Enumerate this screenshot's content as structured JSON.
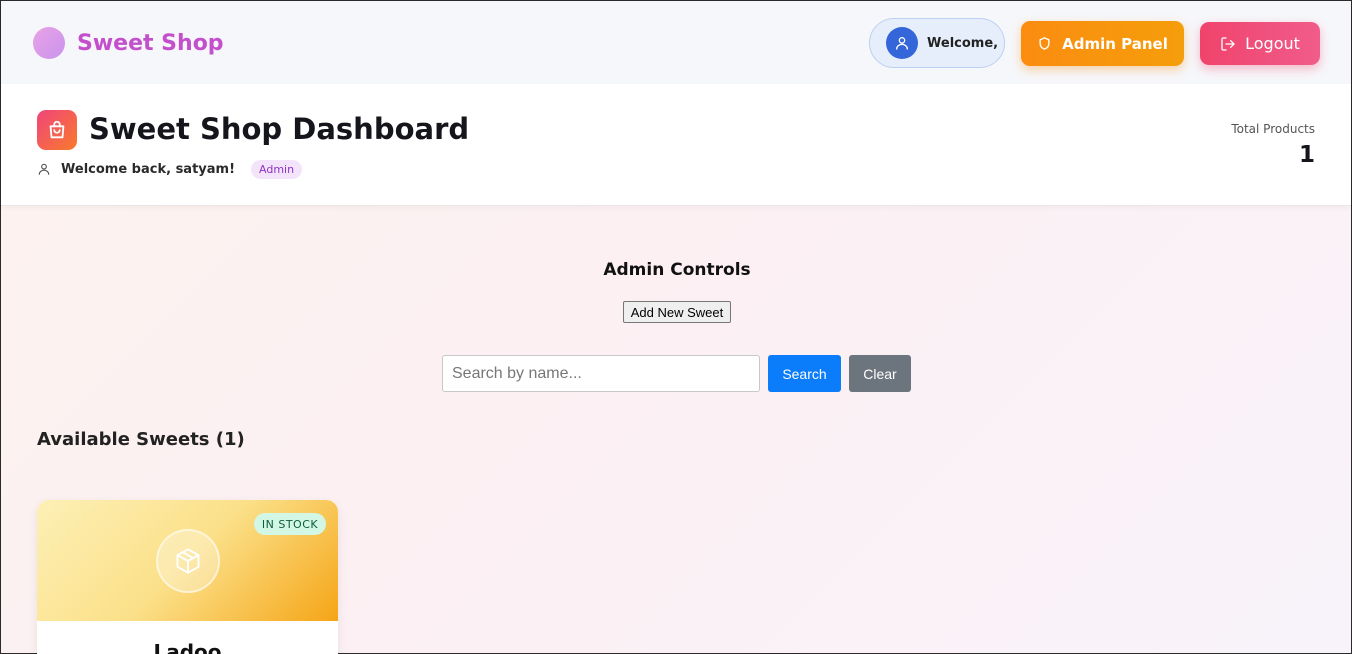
{
  "brand": {
    "name": "Sweet Shop"
  },
  "nav": {
    "welcome_text": "Welcome,",
    "admin_panel_label": "Admin Panel",
    "logout_label": "Logout"
  },
  "header": {
    "title": "Sweet Shop Dashboard",
    "welcome_message": "Welcome back, satyam!",
    "role_badge": "Admin",
    "total_products_label": "Total Products",
    "total_products_value": "1"
  },
  "admin_controls": {
    "title": "Admin Controls",
    "add_button_label": "Add New Sweet"
  },
  "search": {
    "placeholder": "Search by name...",
    "value": "",
    "search_label": "Search",
    "clear_label": "Clear"
  },
  "products_section": {
    "title": "Available Sweets (1)",
    "items": [
      {
        "name": "Ladoo",
        "stock_status": "IN STOCK"
      }
    ]
  },
  "colors": {
    "brand_text": "#c34fcc",
    "admin_panel_bg": "#fb8c10",
    "logout_bg": "#f0436c",
    "search_button_bg": "#0b7dfb",
    "clear_button_bg": "#6c757d",
    "stock_badge_bg": "#d2f8e5"
  },
  "icons": {
    "brand": "brand-logo-icon",
    "user": "user-icon",
    "admin_panel": "shield-icon",
    "logout": "logout-icon",
    "dashboard": "shopping-bag-icon",
    "product_placeholder": "package-icon"
  }
}
